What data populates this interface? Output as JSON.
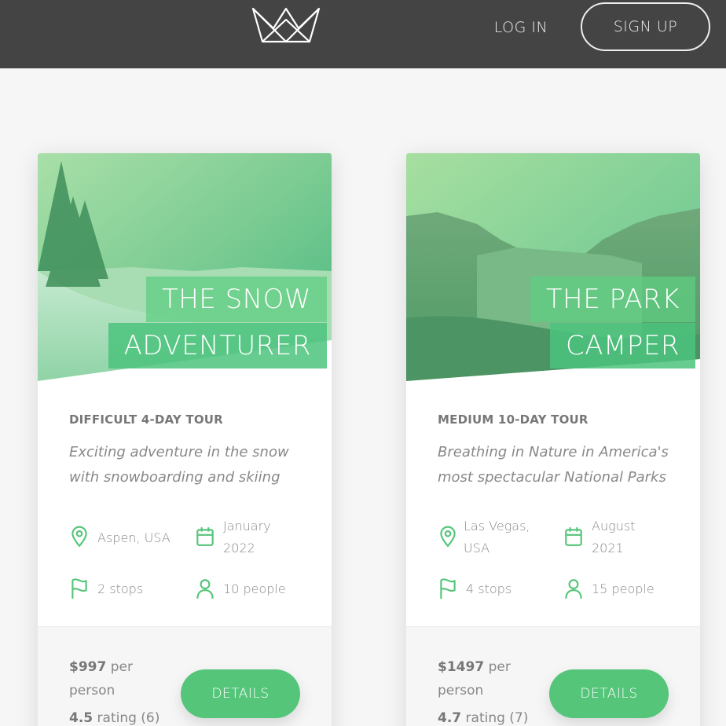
{
  "header": {
    "login_label": "LOG IN",
    "signup_label": "SIGN UP"
  },
  "colors": {
    "topbar": "#444444",
    "accent": "#55c57a",
    "page_bg": "#f6f6f6"
  },
  "tours": [
    {
      "title_line1": "THE SNOW",
      "title_line2": "ADVENTURER",
      "subtitle": "DIFFICULT 4-DAY TOUR",
      "description": "Exciting adventure in the snow with snowboarding and skiing",
      "location": "Aspen, USA",
      "date": "January 2022",
      "stops": "2 stops",
      "people": "10 people",
      "price": "$997",
      "price_unit": "per person",
      "rating_value": "4.5",
      "rating_label": "rating (6)",
      "details_label": "DETAILS"
    },
    {
      "title_line1": "THE PARK",
      "title_line2": "CAMPER",
      "subtitle": "MEDIUM 10-DAY TOUR",
      "description": "Breathing in Nature in America's most spectacular National Parks",
      "location": "Las Vegas, USA",
      "date": "August 2021",
      "stops": "4 stops",
      "people": "15 people",
      "price": "$1497",
      "price_unit": "per person",
      "rating_value": "4.7",
      "rating_label": "rating (7)",
      "details_label": "DETAILS"
    }
  ],
  "icons": {
    "logo": "crown-logo",
    "location": "map-pin-icon",
    "date": "calendar-icon",
    "stops": "flag-icon",
    "people": "user-icon"
  }
}
